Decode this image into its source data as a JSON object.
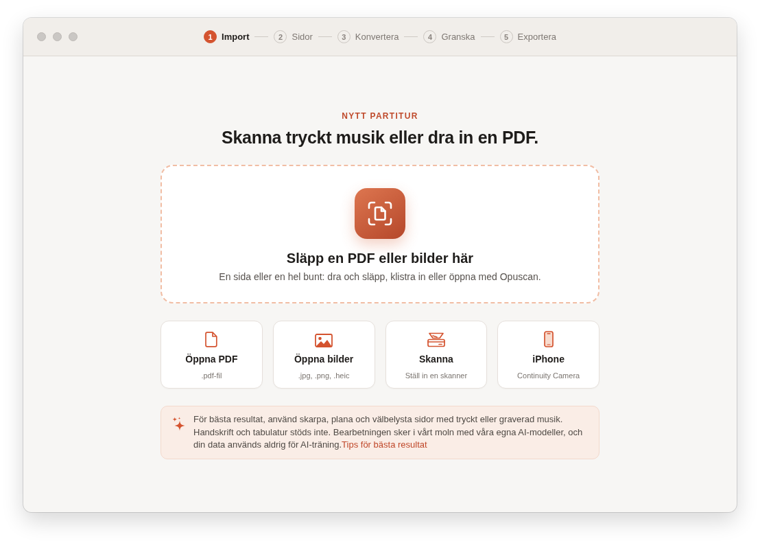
{
  "steps": [
    {
      "number": "1",
      "label": "Import",
      "selected": true
    },
    {
      "number": "2",
      "label": "Sidor",
      "selected": false
    },
    {
      "number": "3",
      "label": "Konvertera",
      "selected": false
    },
    {
      "number": "4",
      "label": "Granska",
      "selected": false
    },
    {
      "number": "5",
      "label": "Exportera",
      "selected": false
    }
  ],
  "header": {
    "eyebrow": "NYTT PARTITUR",
    "title": "Skanna tryckt musik eller dra in en PDF."
  },
  "drop_zone": {
    "title": "Släpp en PDF eller bilder här",
    "subtitle": "En sida eller en hel bunt: dra och släpp, klistra in eller öppna med Opuscan."
  },
  "options": [
    {
      "kind": "pdf",
      "title": "Öppna PDF",
      "subtitle": ".pdf-fil"
    },
    {
      "kind": "images",
      "title": "Öppna bilder",
      "subtitle": ".jpg, .png, .heic"
    },
    {
      "kind": "scanner",
      "title": "Skanna",
      "subtitle": "Ställ in en skanner"
    },
    {
      "kind": "phone",
      "title": "iPhone",
      "subtitle": "Continuity Camera"
    }
  ],
  "tip": {
    "text": "För bästa resultat, använd skarpa, plana och välbelysta sidor med tryckt eller graverad musik. Handskrift och tabulatur stöds inte. Bearbetningen sker i vårt moln med våra egna AI-modeller, och din data används aldrig för AI-träning.",
    "link": "Tips för bästa resultat"
  }
}
